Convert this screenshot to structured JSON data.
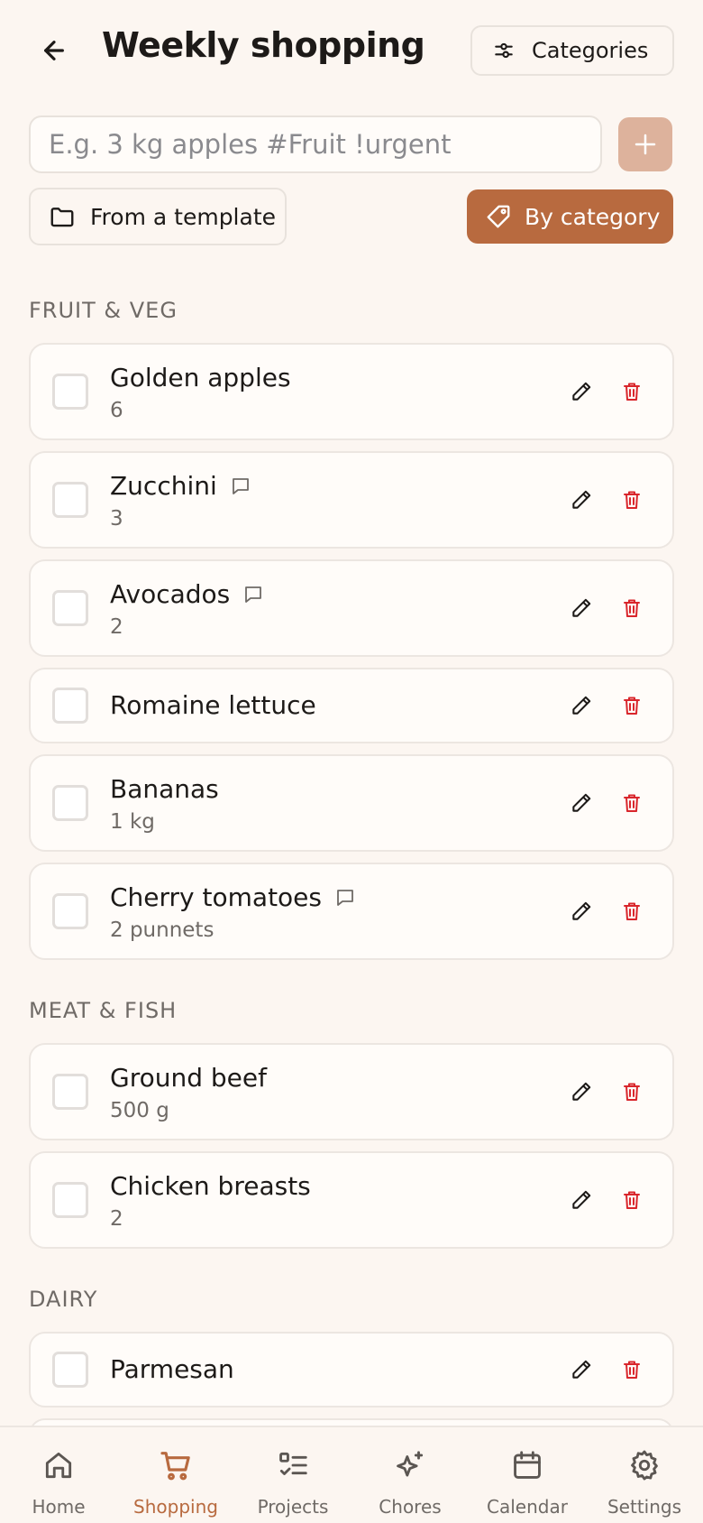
{
  "header": {
    "title": "Weekly shopping",
    "categories_label": "Categories"
  },
  "add_form": {
    "placeholder": "E.g. 3 kg apples #Fruit !urgent",
    "add_button_label": "+"
  },
  "actions": {
    "template_label": "From a template",
    "by_category_label": "By category"
  },
  "sections": [
    {
      "label": "FRUIT & VEG",
      "items": [
        {
          "name": "Golden apples",
          "qty": "6",
          "has_note": false
        },
        {
          "name": "Zucchini",
          "qty": "3",
          "has_note": true
        },
        {
          "name": "Avocados",
          "qty": "2",
          "has_note": true
        },
        {
          "name": "Romaine lettuce",
          "qty": "",
          "has_note": false
        },
        {
          "name": "Bananas",
          "qty": "1 kg",
          "has_note": false
        },
        {
          "name": "Cherry tomatoes",
          "qty": "2 punnets",
          "has_note": true
        }
      ]
    },
    {
      "label": "MEAT & FISH",
      "items": [
        {
          "name": "Ground beef",
          "qty": "500 g",
          "has_note": false
        },
        {
          "name": "Chicken breasts",
          "qty": "2",
          "has_note": false
        }
      ]
    },
    {
      "label": "DAIRY",
      "items": [
        {
          "name": "Parmesan",
          "qty": "",
          "has_note": false
        }
      ]
    }
  ],
  "nav": [
    {
      "label": "Home",
      "icon": "home-icon",
      "active": false
    },
    {
      "label": "Shopping",
      "icon": "cart-icon",
      "active": true
    },
    {
      "label": "Projects",
      "icon": "checklist-icon",
      "active": false
    },
    {
      "label": "Chores",
      "icon": "sparkles-icon",
      "active": false
    },
    {
      "label": "Calendar",
      "icon": "calendar-icon",
      "active": false
    },
    {
      "label": "Settings",
      "icon": "gear-icon",
      "active": false
    }
  ],
  "colors": {
    "background": "#fcf6f1",
    "accent": "#b86a3f",
    "accent_light": "#ddb29c",
    "delete": "#d9262c"
  }
}
